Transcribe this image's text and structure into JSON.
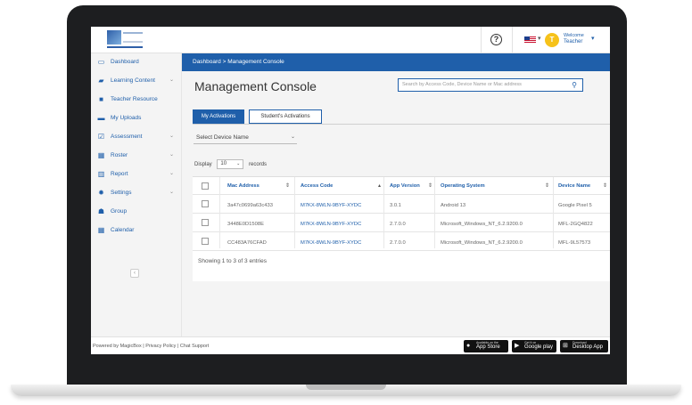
{
  "header": {
    "welcome": "Welcome",
    "user_role": "Teacher",
    "avatar_letter": "T",
    "help_symbol": "?"
  },
  "sidebar": {
    "items": [
      {
        "label": "Dashboard",
        "icon": "monitor-icon",
        "has_submenu": false
      },
      {
        "label": "Learning Content",
        "icon": "book-icon",
        "has_submenu": true
      },
      {
        "label": "Teacher Resource",
        "icon": "briefcase-icon",
        "has_submenu": false
      },
      {
        "label": "My Uploads",
        "icon": "folder-icon",
        "has_submenu": false
      },
      {
        "label": "Assessment",
        "icon": "checklist-icon",
        "has_submenu": true
      },
      {
        "label": "Roster",
        "icon": "calendar-icon",
        "has_submenu": true
      },
      {
        "label": "Report",
        "icon": "chart-icon",
        "has_submenu": true
      },
      {
        "label": "Settings",
        "icon": "gear-icon",
        "has_submenu": true
      },
      {
        "label": "Group",
        "icon": "users-icon",
        "has_submenu": false
      },
      {
        "label": "Calendar",
        "icon": "calendar-icon",
        "has_submenu": false
      }
    ]
  },
  "breadcrumb": "Dashboard  >  Management Console",
  "page": {
    "title": "Management Console",
    "search_placeholder": "Search by Access Code, Device Name or Mac address"
  },
  "tabs": [
    {
      "label": "My Activations",
      "active": true
    },
    {
      "label": "Student's Activations",
      "active": false
    }
  ],
  "device_select": "Select Device Name",
  "display": {
    "prefix": "Display",
    "value": "10",
    "suffix": "records"
  },
  "table": {
    "columns": [
      "Mac Address",
      "Access Code",
      "App Version",
      "Operating System",
      "Device Name"
    ],
    "rows": [
      [
        "3a47c0699a63c433",
        "M7KX-8WLN-9BYF-XYDC",
        "3.0.1",
        "Android 13",
        "Google Pixel 5"
      ],
      [
        "3448E0D1508E",
        "M7KX-8WLN-9BYF-XYDC",
        "2.7.0.0",
        "Microsoft_Windows_NT_6.2.9200.0",
        "MFL-2GQ4822"
      ],
      [
        "CC483A76CFAD",
        "M7KX-8WLN-9BYF-XYDC",
        "2.7.0.0",
        "Microsoft_Windows_NT_6.2.9200.0",
        "MFL-9L57573"
      ]
    ],
    "showing": "Showing 1 to 3 of 3 entries"
  },
  "footer": {
    "text": "Powered by MagicBox  |  Privacy Policy  |  Chat Support",
    "badges": [
      {
        "small": "Available on the",
        "big": "App Store",
        "icon": "apple-icon"
      },
      {
        "small": "Get it on",
        "big": "Google play",
        "icon": "play-icon"
      },
      {
        "small": "Download",
        "big": "Desktop App",
        "icon": "windows-icon"
      }
    ]
  },
  "colors": {
    "primary": "#1f5faa",
    "avatar": "#f6c21a",
    "bezel": "#1d1e20"
  }
}
